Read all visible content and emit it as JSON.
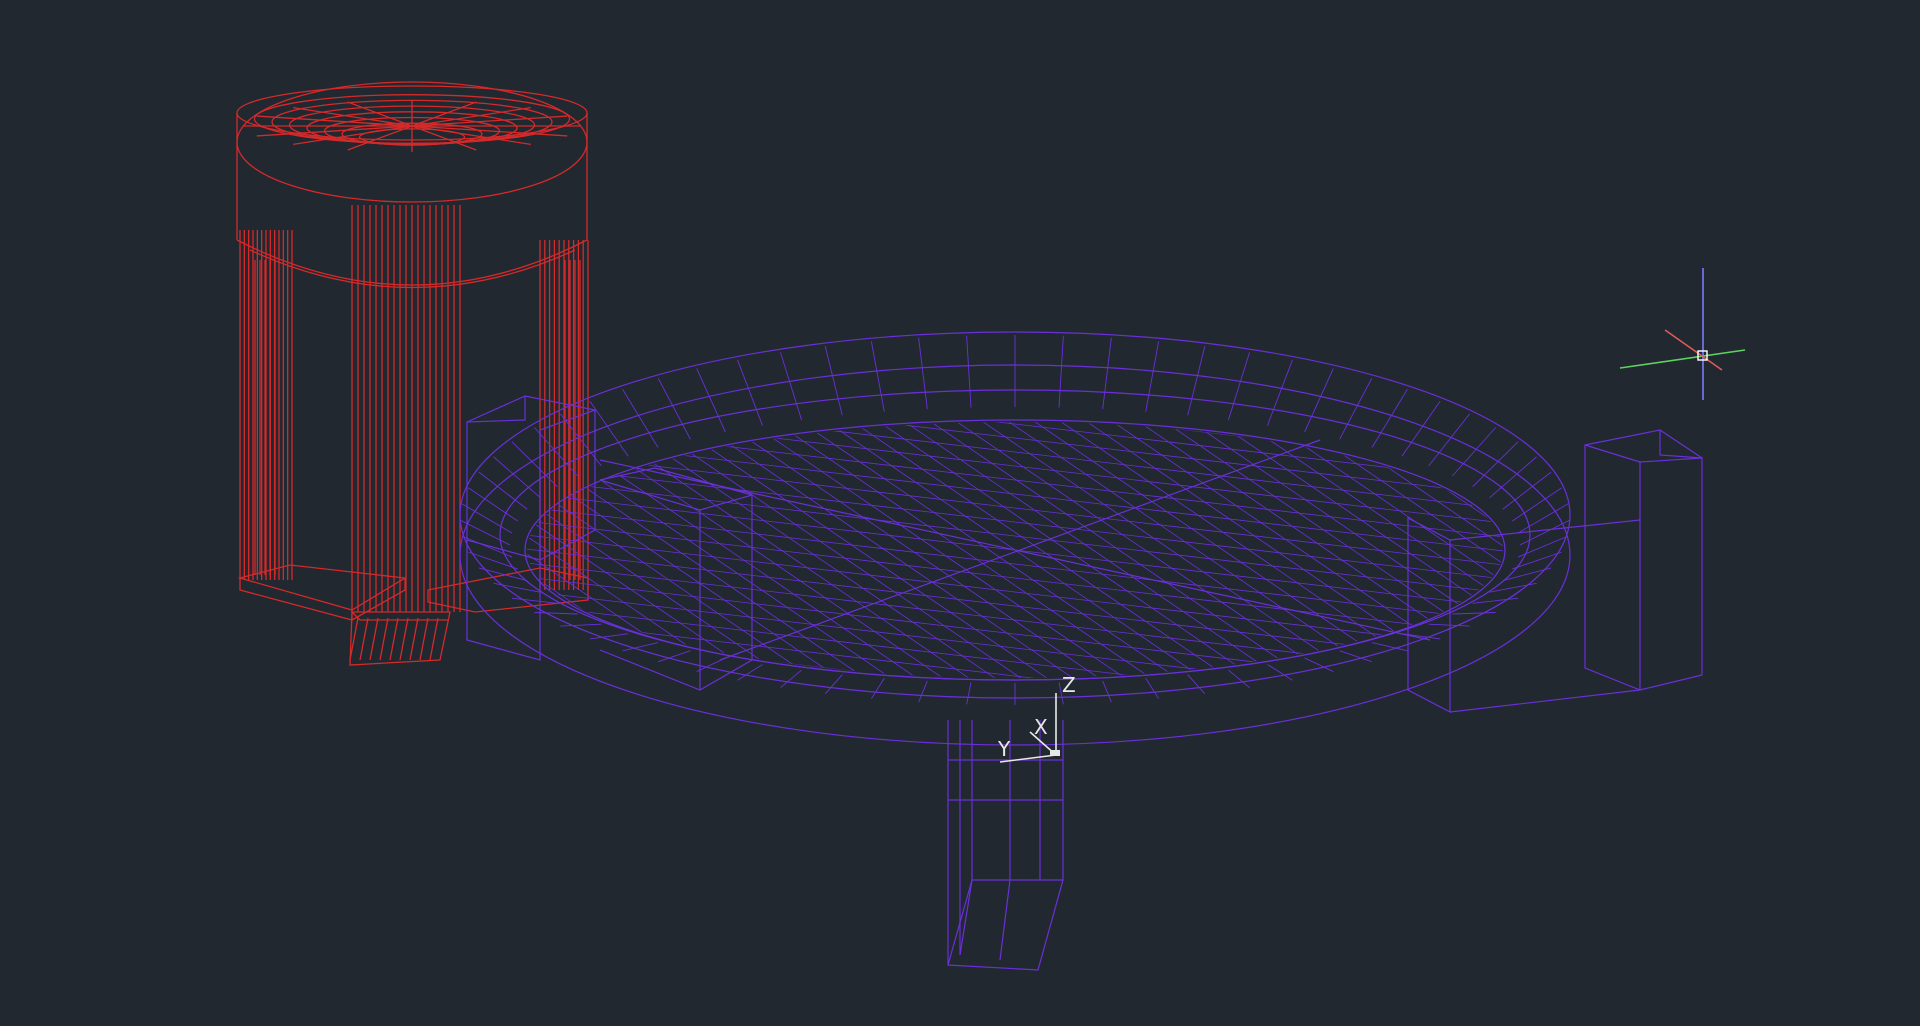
{
  "canvas": {
    "background": "#212830"
  },
  "models": {
    "red_stand": {
      "color": "#d42a2a"
    },
    "purple_tray": {
      "color": "#6a30d8"
    }
  },
  "ucs_icon": {
    "x_label": "X",
    "y_label": "Y",
    "z_label": "Z",
    "color": "#e8e8e8"
  },
  "cursor": {
    "icon": "crosshair-icon",
    "x_axis_color": "#e05a5a",
    "y_axis_color": "#5ed25e",
    "z_axis_color": "#7a7aff"
  }
}
